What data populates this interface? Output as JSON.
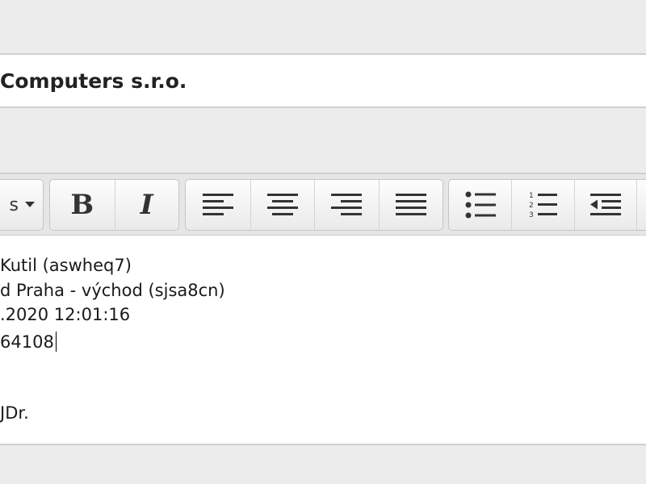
{
  "title_field": {
    "value": "Computers s.r.o."
  },
  "toolbar": {
    "style_dropdown_fragment": "s",
    "bold_label": "B",
    "italic_label": "I",
    "icons": {
      "dropdown": "chevron-down-icon",
      "align_left": "align-left-icon",
      "align_center": "align-center-icon",
      "align_right": "align-right-icon",
      "justify": "align-justify-icon",
      "bullet_list": "bullet-list-icon",
      "numbered_list": "numbered-list-icon",
      "outdent": "outdent-icon"
    }
  },
  "editor": {
    "lines": [
      "Kutil (aswheq7)",
      "d Praha - východ (sjsa8cn)",
      ".2020 12:01:16",
      "64108",
      "",
      "",
      "JDr."
    ]
  },
  "colors": {
    "background": "#ececec",
    "field": "#ffffff",
    "border": "#cfcfcf",
    "toolbar": "#e6e6e6",
    "text": "#1a1a1a"
  }
}
